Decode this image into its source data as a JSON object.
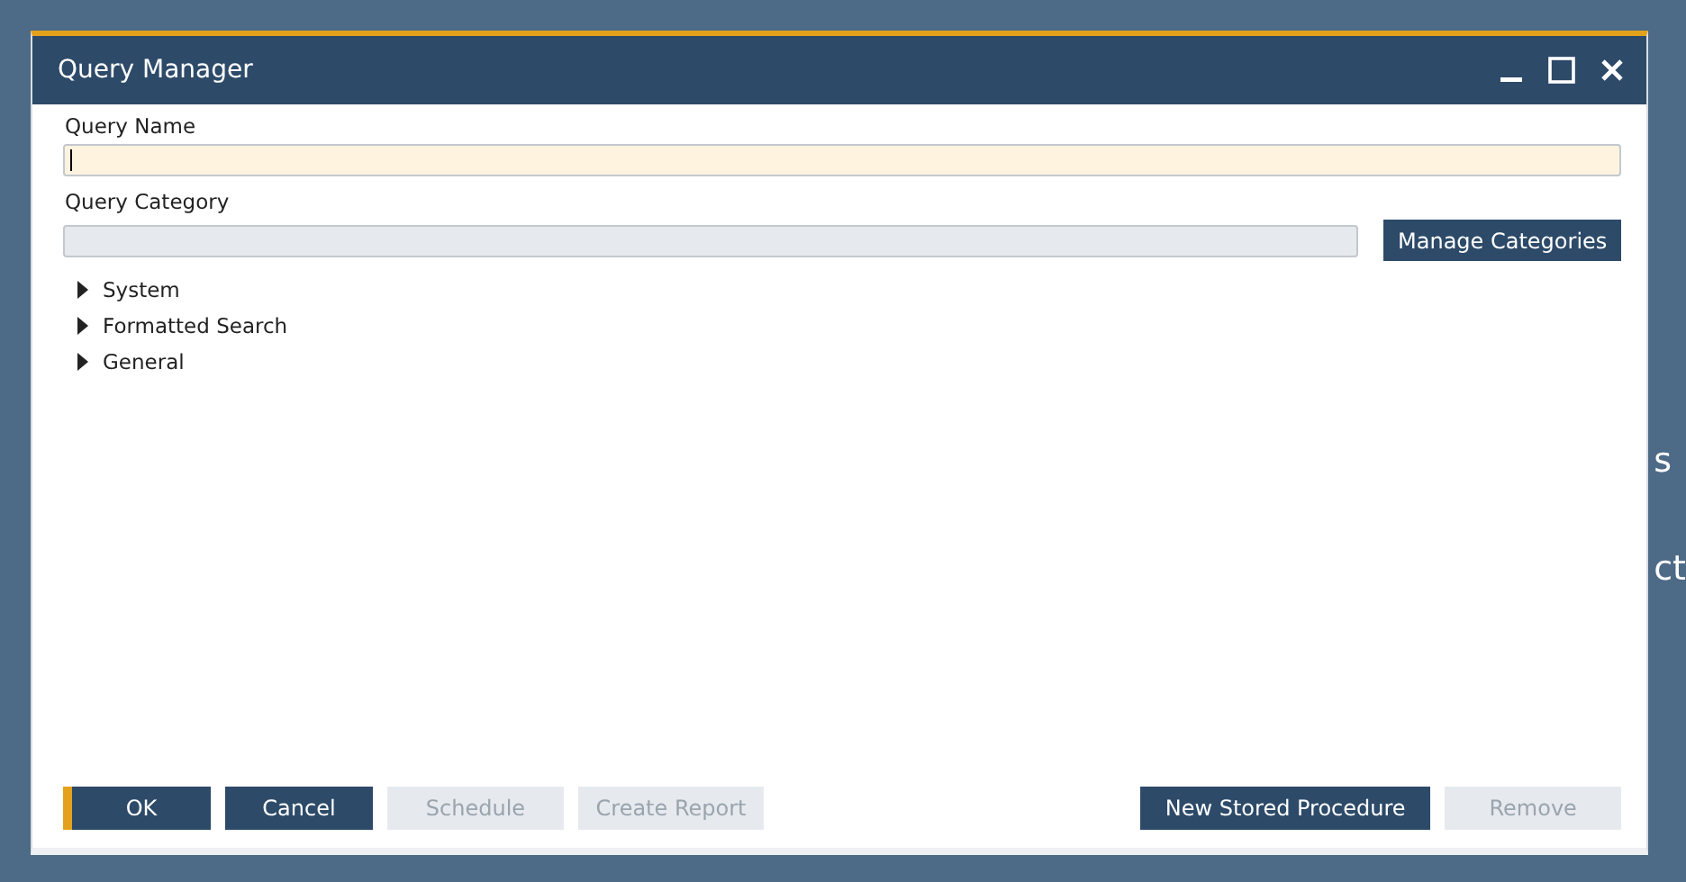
{
  "background": {
    "texts": [
      "s",
      "ct"
    ]
  },
  "window": {
    "title": "Query Manager"
  },
  "query_name": {
    "label": "Query Name"
  },
  "query_category": {
    "label": "Query Category",
    "disabled": true
  },
  "manage_categories": {
    "label": "Manage Categories",
    "disabled": false
  },
  "tree": [
    {
      "label": "System",
      "expanded": false
    },
    {
      "label": "Formatted Search",
      "expanded": false
    },
    {
      "label": "General",
      "expanded": false
    }
  ],
  "buttons_left": [
    {
      "label": "OK",
      "disabled": false,
      "default": true
    },
    {
      "label": "Cancel",
      "disabled": false,
      "default": false
    },
    {
      "label": "Schedule",
      "disabled": true,
      "default": false
    },
    {
      "label": "Create Report",
      "disabled": true,
      "default": false
    }
  ],
  "buttons_right": [
    {
      "label": "New Stored Procedure",
      "disabled": false,
      "default": false
    },
    {
      "label": "Remove",
      "disabled": true,
      "default": false
    }
  ]
}
